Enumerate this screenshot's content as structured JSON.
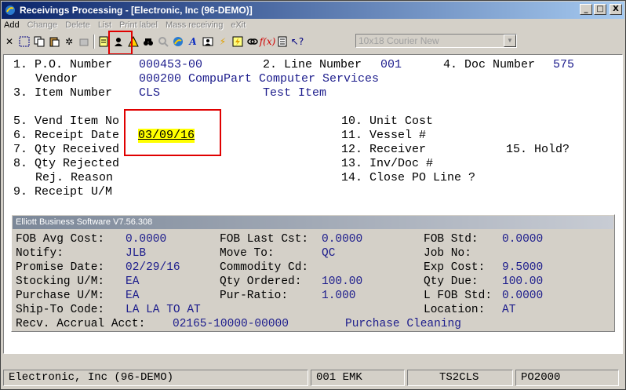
{
  "window": {
    "title": "Receivings Processing - [Electronic, Inc (96-DEMO)]",
    "controls": [
      "_",
      "□",
      "X"
    ]
  },
  "menu": {
    "items": [
      {
        "label": "Add",
        "enabled": true
      },
      {
        "label": "Change",
        "enabled": false
      },
      {
        "label": "Delete",
        "enabled": false
      },
      {
        "label": "List",
        "enabled": false
      },
      {
        "label": "Print label",
        "enabled": false
      },
      {
        "label": "Mass receiving",
        "enabled": false
      },
      {
        "label": "eXit",
        "enabled": false
      }
    ]
  },
  "toolbar": {
    "font_select_value": "10x18 Courier New"
  },
  "form": {
    "f1_label": "1. P.O. Number",
    "po_number": "000453-00",
    "f2_label": "2. Line Number",
    "line_number": "001",
    "f4_label": "4. Doc Number",
    "doc_number": "575",
    "vendor_label": "Vendor",
    "vendor_value": "000200 CompuPart Computer Services",
    "f3_label": "3. Item Number",
    "item_number": "CLS",
    "item_desc": "Test Item",
    "f5_label": "5. Vend Item No",
    "f6_label": "6. Receipt Date",
    "receipt_date": "03/09/16",
    "f7_label": "7. Qty Received",
    "f8_label": "8. Qty Rejected",
    "rej_reason_label": "Rej. Reason",
    "f9_label": "9. Receipt U/M",
    "f10_label": "10. Unit Cost",
    "f11_label": "11. Vessel #",
    "f12_label": "12. Receiver",
    "f13_label": "13. Inv/Doc #",
    "f14_label": "14. Close PO Line ?",
    "f15_label": "15. Hold?"
  },
  "info": {
    "header": "Elliott Business Software V7.56.308",
    "fob_avg_cost_label": "FOB Avg Cost:",
    "fob_avg_cost": "0.0000",
    "fob_last_cst_label": "FOB Last Cst:",
    "fob_last_cst": "0.0000",
    "fob_std_label": "FOB Std:",
    "fob_std": "0.0000",
    "notify_label": "Notify:",
    "notify": "JLB",
    "move_to_label": "Move To:",
    "move_to": "QC",
    "job_no_label": "Job No:",
    "promise_date_label": "Promise Date:",
    "promise_date": "02/29/16",
    "commodity_label": "Commodity Cd:",
    "exp_cost_label": "Exp Cost:",
    "exp_cost": "9.5000",
    "stocking_um_label": "Stocking U/M:",
    "stocking_um": "EA",
    "qty_ordered_label": "Qty Ordered:",
    "qty_ordered": "100.00",
    "qty_due_label": "Qty Due:",
    "qty_due": "100.00",
    "purchase_um_label": "Purchase U/M:",
    "purchase_um": "EA",
    "pur_ratio_label": "Pur-Ratio:",
    "pur_ratio": "1.000",
    "l_fob_std_label": "L FOB Std:",
    "l_fob_std": "0.0000",
    "ship_to_label": "Ship-To Code:",
    "ship_to": "LA LA TO AT",
    "location_label": "Location:",
    "location": "AT",
    "recv_accrual_label": "Recv. Accrual Acct:",
    "recv_accrual": "02165-10000-00000",
    "recv_accrual_desc": "Purchase Cleaning"
  },
  "status": {
    "company": "Electronic, Inc (96-DEMO)",
    "user": "001 EMK",
    "terminal": "TS2CLS",
    "program": "PO2000"
  }
}
